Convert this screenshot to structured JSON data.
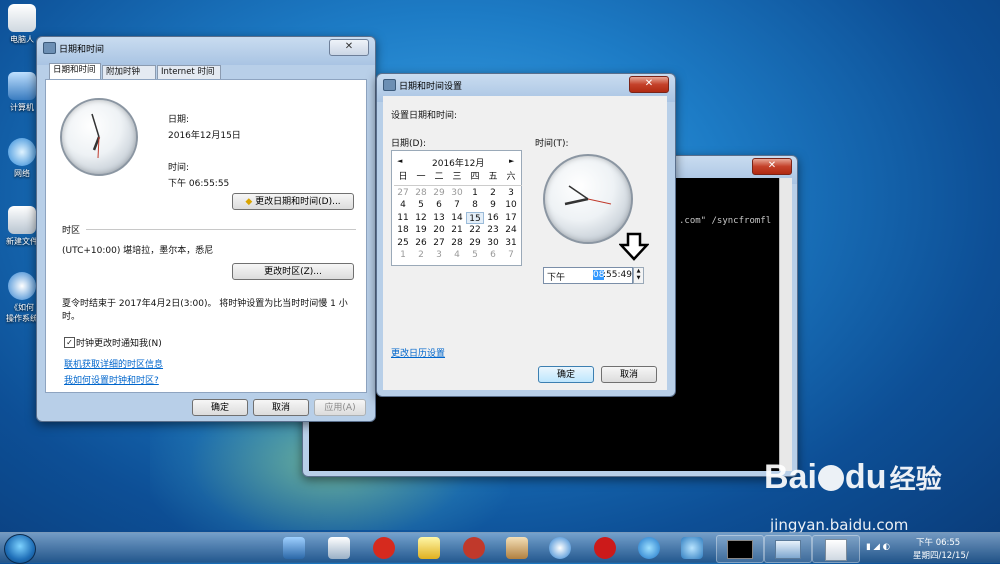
{
  "desktop": {
    "icons": [
      {
        "label": "电脑人"
      },
      {
        "label": "计算机"
      },
      {
        "label": "网络"
      },
      {
        "label": "新建文件"
      },
      {
        "label": "《如何"
      }
    ],
    "icon_line2": "操作系统"
  },
  "datetime_window": {
    "title": "日期和时间",
    "close": "✕",
    "tabs": [
      "日期和时间",
      "附加时钟",
      "Internet 时间"
    ],
    "date_label": "日期:",
    "date_value": "2016年12月15日",
    "time_label": "时间:",
    "time_value": "下午 06:55:55",
    "change_datetime_button": "更改日期和时间(D)...",
    "timezone_section": "时区",
    "timezone_value": "(UTC+10:00) 堪培拉，墨尔本，悉尼",
    "change_timezone_button": "更改时区(Z)...",
    "dst_text_1": "夏令时结束于 2017年4月2日(3:00)。 将时钟设置为比当时时间慢 1 小",
    "dst_text_2": "时。",
    "notify_checkbox": "时钟更改时通知我(N)",
    "link_timezone_info": "联机获取详细的时区信息",
    "link_how_to": "我如何设置时钟和时区?",
    "ok": "确定",
    "cancel": "取消",
    "apply": "应用(A)"
  },
  "settings_window": {
    "title": "日期和时间设置",
    "close": "✕",
    "heading": "设置日期和时间:",
    "date_label": "日期(D):",
    "time_label": "时间(T):",
    "calendar": {
      "month": "2016年12月",
      "prev": "◄",
      "next": "►",
      "weekdays": [
        "日",
        "一",
        "二",
        "三",
        "四",
        "五",
        "六"
      ],
      "weeks": [
        [
          "27",
          "28",
          "29",
          "30",
          "1",
          "2",
          "3"
        ],
        [
          "4",
          "5",
          "6",
          "7",
          "8",
          "9",
          "10"
        ],
        [
          "11",
          "12",
          "13",
          "14",
          "15",
          "16",
          "17"
        ],
        [
          "18",
          "19",
          "20",
          "21",
          "22",
          "23",
          "24"
        ],
        [
          "25",
          "26",
          "27",
          "28",
          "29",
          "30",
          "31"
        ],
        [
          "1",
          "2",
          "3",
          "4",
          "5",
          "6",
          "7"
        ]
      ],
      "selected_day": "15"
    },
    "ampm": "下午",
    "time_hour": "08",
    "time_rest": ":55:49",
    "change_calendar_link": "更改日历设置",
    "ok": "确定",
    "cancel": "取消"
  },
  "console": {
    "text": ".com\" /syncfromfl"
  },
  "tray": {
    "time": "下午 06:55",
    "date": "星期四/12/15/"
  },
  "watermark": {
    "brand": "Bai",
    "brand2": "du",
    "cn": "经验",
    "url": "jingyan.baidu.com"
  }
}
